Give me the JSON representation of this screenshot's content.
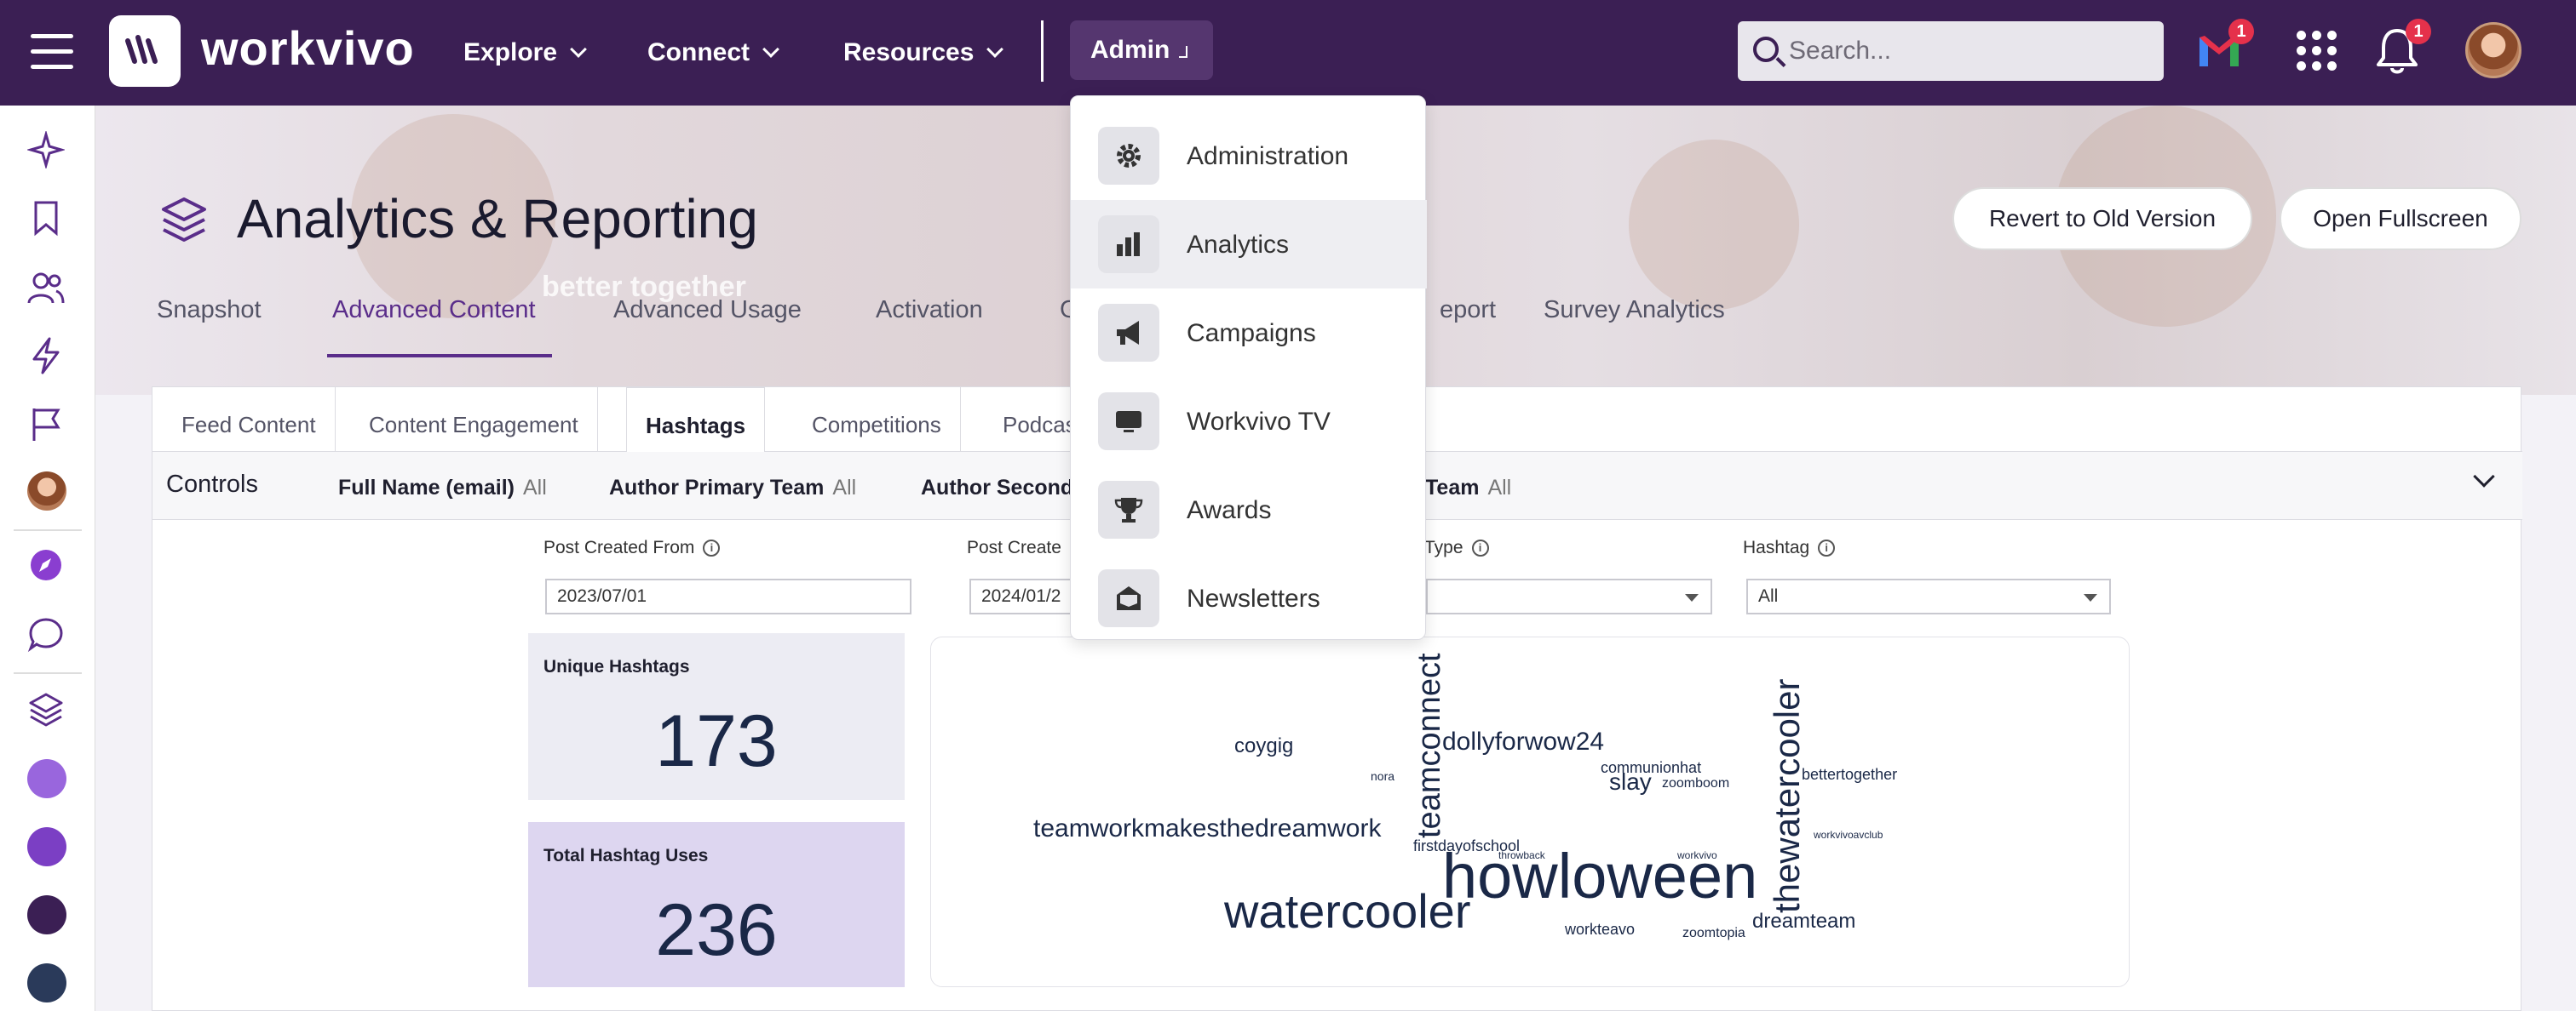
{
  "header": {
    "logo_text": "workvivo",
    "nav": [
      {
        "label": "Explore"
      },
      {
        "label": "Connect"
      },
      {
        "label": "Resources"
      }
    ],
    "admin_label": "Admin",
    "search_placeholder": "Search...",
    "mail_badge": "1",
    "bell_badge": "1"
  },
  "page": {
    "title": "Analytics & Reporting",
    "banner_text": "better together",
    "buttons": {
      "revert": "Revert to Old Version",
      "fullscreen": "Open Fullscreen"
    },
    "tabs": [
      {
        "label": "Snapshot"
      },
      {
        "label": "Advanced Content"
      },
      {
        "label": "Advanced Usage"
      },
      {
        "label": "Activation"
      },
      {
        "label": "G"
      },
      {
        "label": "eport"
      },
      {
        "label": "Survey Analytics"
      }
    ]
  },
  "report": {
    "subtabs": [
      {
        "label": "Feed Content"
      },
      {
        "label": "Content Engagement"
      },
      {
        "label": "Hashtags"
      },
      {
        "label": "Competitions"
      },
      {
        "label": "Podcast"
      }
    ],
    "controls_label": "Controls",
    "filters": [
      {
        "name": "Full Name (email)",
        "value": "All"
      },
      {
        "name": "Author Primary Team",
        "value": "All"
      },
      {
        "name": "Author Second",
        "value": ""
      },
      {
        "name": "Team",
        "value": "All"
      }
    ],
    "fields": {
      "from_label": "Post Created From",
      "from_value": "2023/07/01",
      "to_label": "Post Create",
      "to_value": "2024/01/2",
      "type_label": "Type",
      "type_value": "",
      "hashtag_label": "Hashtag",
      "hashtag_value": "All"
    },
    "kpis": {
      "unique_label": "Unique Hashtags",
      "unique_value": "173",
      "total_label": "Total Hashtag Uses",
      "total_value": "236"
    },
    "cloud_words": [
      {
        "text": "howloween"
      },
      {
        "text": "watercooler"
      },
      {
        "text": "teamworkmakesthedreamwork"
      },
      {
        "text": "dollyforwow24"
      },
      {
        "text": "coygig"
      },
      {
        "text": "slay"
      },
      {
        "text": "communionhat"
      },
      {
        "text": "zoomboom"
      },
      {
        "text": "bettertogether"
      },
      {
        "text": "firstdayofschool"
      },
      {
        "text": "dreamteam"
      },
      {
        "text": "workteavo"
      },
      {
        "text": "zoomtopia"
      },
      {
        "text": "workvivoavclub"
      },
      {
        "text": "throwback"
      },
      {
        "text": "nora"
      },
      {
        "text": "workvivo"
      },
      {
        "text": "teamconnect"
      },
      {
        "text": "thewatercooler"
      }
    ]
  },
  "admin_menu": [
    {
      "label": "Administration",
      "icon": "gear-icon"
    },
    {
      "label": "Analytics",
      "icon": "bar-chart-icon"
    },
    {
      "label": "Campaigns",
      "icon": "megaphone-icon"
    },
    {
      "label": "Workvivo TV",
      "icon": "tv-icon"
    },
    {
      "label": "Awards",
      "icon": "trophy-icon"
    },
    {
      "label": "Newsletters",
      "icon": "newsletter-icon"
    }
  ],
  "colors": {
    "header_bg": "#3b1f54",
    "accent": "#5a2d8a",
    "badge": "#e5314b",
    "kpi_unique_bg": "#ececf3",
    "kpi_total_bg": "#ddd6f0"
  }
}
